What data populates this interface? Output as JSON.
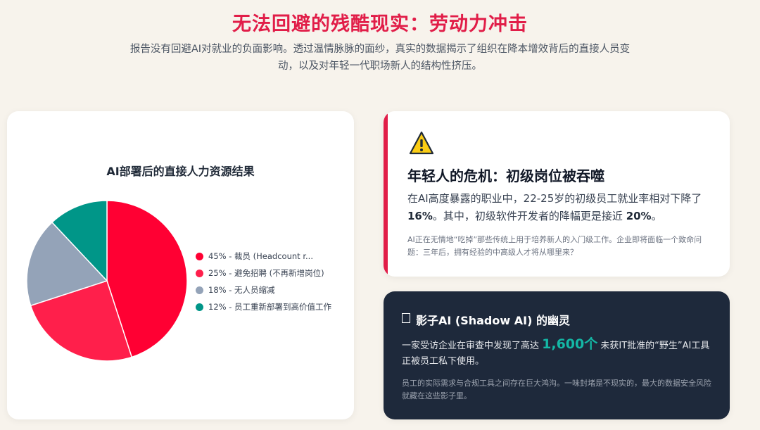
{
  "header": {
    "title": "无法回避的残酷现实：劳动力冲击",
    "subtitle": "报告没有回避AI对就业的负面影响。透过温情脉脉的面纱，真实的数据揭示了组织在降本增效背后的直接人员变动，以及对年轻一代职场新人的结构性挤压。"
  },
  "chart_data": {
    "type": "pie",
    "title": "AI部署后的直接人力资源结果",
    "categories": [
      "裁员 (Headcount r...",
      "避免招聘 (不再新增岗位)",
      "无人员缩减",
      "员工重新部署到高价值工作"
    ],
    "values": [
      45,
      25,
      18,
      12
    ],
    "colors": [
      "#ff0033",
      "#ff1f4b",
      "#94a3b8",
      "#009688"
    ],
    "legend": [
      "45% - 裁员 (Headcount r...",
      "25% - 避免招聘 (不再新增岗位)",
      "18% - 无人员缩减",
      "12% - 员工重新部署到高价值工作"
    ],
    "legend_position": "right"
  },
  "youth_card": {
    "icon": "warning-icon",
    "title": "年轻人的危机：初级岗位被吞噬",
    "body_part1": "在AI高度暴露的职业中，22-25岁的初级员工就业率相对下降了 ",
    "body_value1": "16%",
    "body_part2": "。其中，初级软件开发者的降幅更是接近 ",
    "body_value2": "20%",
    "body_part3": "。",
    "note": "AI正在无情地“吃掉”那些传统上用于培养新人的入门级工作。企业即将面临一个致命问题：三年后，拥有经验的中高级人才将从哪里来？",
    "accent_color": "#e11d48"
  },
  "shadow_card": {
    "icon": "ghost-icon",
    "title": "影子AI (Shadow AI) 的幽灵",
    "body_part1": "一家受访企业在审查中发现了高达 ",
    "body_highlight": "1,600个",
    "body_part2": " 未获IT批准的“野生”AI工具正被员工私下使用。",
    "note": "员工的实际需求与合规工具之间存在巨大鸿沟。一味封堵是不现实的，最大的数据安全风险就藏在这些影子里。",
    "highlight_color": "#14b8a6"
  }
}
